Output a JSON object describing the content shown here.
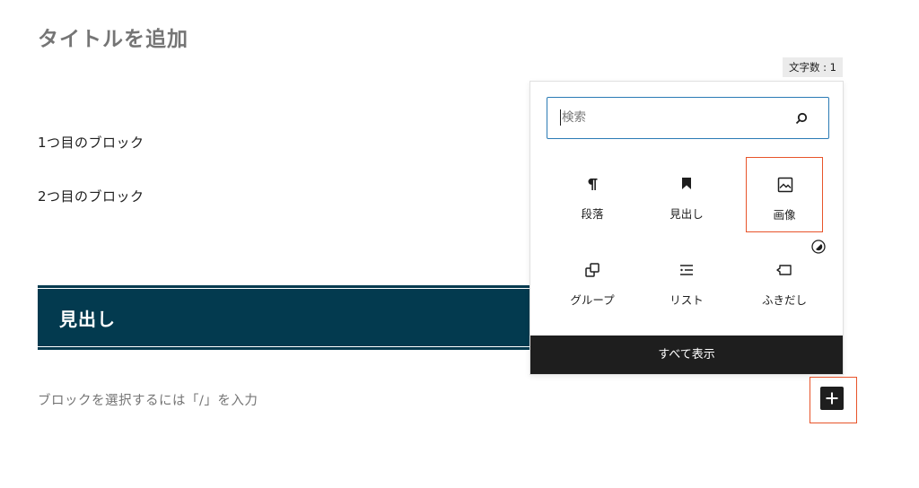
{
  "editor": {
    "title_placeholder": "タイトルを追加",
    "char_count": "文字数 : 1",
    "paragraph_1": "1つ目のブロック",
    "paragraph_2": "2つ目のブロック",
    "heading": "見出し",
    "empty_block_placeholder": "ブロックを選択するには「/」を入力"
  },
  "inserter": {
    "search": {
      "value": "",
      "placeholder": "検索",
      "icon": "search-icon"
    },
    "blocks": [
      {
        "label": "段落",
        "icon": "paragraph-icon"
      },
      {
        "label": "見出し",
        "icon": "heading-bookmark-icon"
      },
      {
        "label": "画像",
        "icon": "image-icon",
        "highlighted": true
      },
      {
        "label": "グループ",
        "icon": "group-icon"
      },
      {
        "label": "リスト",
        "icon": "list-icon"
      },
      {
        "label": "ふきだし",
        "icon": "speech-bubble-icon"
      }
    ],
    "browse_all": "すべて表示"
  },
  "colors": {
    "heading_background": "#033a4f",
    "highlight": "#e8542a",
    "search_focus": "#2b7bb5",
    "dark": "#1e1e1e"
  }
}
